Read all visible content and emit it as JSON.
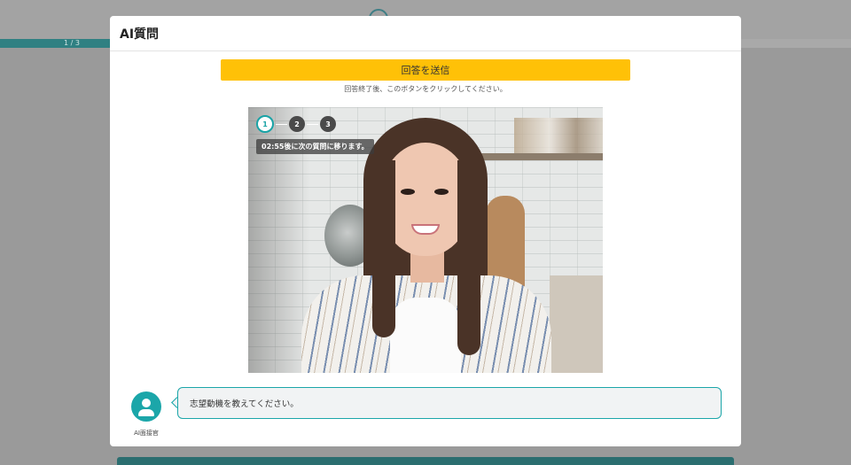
{
  "background": {
    "progress_label": "1 / 3",
    "progress_fraction": 0.333
  },
  "modal": {
    "title": "AI質問",
    "submit_label": "回答を送信",
    "submit_hint": "回答終了後、このボタンをクリックしてください。"
  },
  "video": {
    "steps": [
      "1",
      "2",
      "3"
    ],
    "active_step": 1,
    "timer_text": "02:55後に次の質問に移ります。"
  },
  "interviewer": {
    "label": "AI面接官",
    "question": "志望動機を教えてください。",
    "icon": "person-icon"
  },
  "colors": {
    "accent": "#1ba6a9",
    "submit": "#ffc107"
  }
}
